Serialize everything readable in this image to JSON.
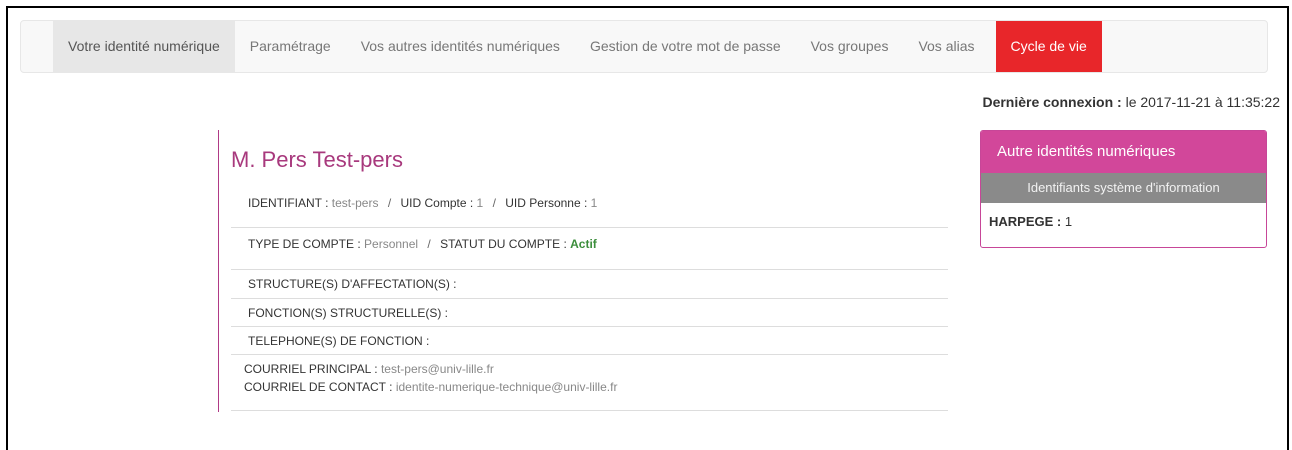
{
  "nav": {
    "tabs": [
      {
        "label": "Votre identité numérique"
      },
      {
        "label": "Paramétrage"
      },
      {
        "label": "Vos autres identités numériques"
      },
      {
        "label": "Gestion de votre mot de passe"
      },
      {
        "label": "Vos groupes"
      },
      {
        "label": "Vos alias"
      },
      {
        "label": "Cycle de vie"
      }
    ]
  },
  "last_connection": {
    "label": "Dernière connexion :",
    "value": "le 2017-11-21 à 11:35:22"
  },
  "identity": {
    "name": "M. Pers Test-pers",
    "identifiant_label": "IDENTIFIANT :",
    "identifiant_value": "test-pers",
    "uid_compte_label": "UID Compte :",
    "uid_compte_value": "1",
    "uid_personne_label": "UID Personne :",
    "uid_personne_value": "1",
    "separator": "/",
    "type_compte_label": "TYPE DE COMPTE :",
    "type_compte_value": "Personnel",
    "statut_label": "STATUT DU COMPTE :",
    "statut_value": "Actif",
    "structures_label": "STRUCTURE(S) D'AFFECTATION(S) :",
    "fonctions_label": "FONCTION(S) STRUCTURELLE(S) :",
    "telephones_label": "TELEPHONE(S) DE FONCTION :",
    "courriel_principal_label": "COURRIEL PRINCIPAL :",
    "courriel_principal_value": "test-pers@univ-lille.fr",
    "courriel_contact_label": "COURRIEL DE CONTACT :",
    "courriel_contact_value": "identite-numerique-technique@univ-lille.fr"
  },
  "panel": {
    "title": "Autre identités numériques",
    "subtitle": "Identifiants système d'information",
    "harpege_label": "HARPEGE :",
    "harpege_value": "1"
  },
  "colors": {
    "accent": "#d2479a",
    "danger": "#e8262a",
    "active_status": "#3c8e3c"
  }
}
